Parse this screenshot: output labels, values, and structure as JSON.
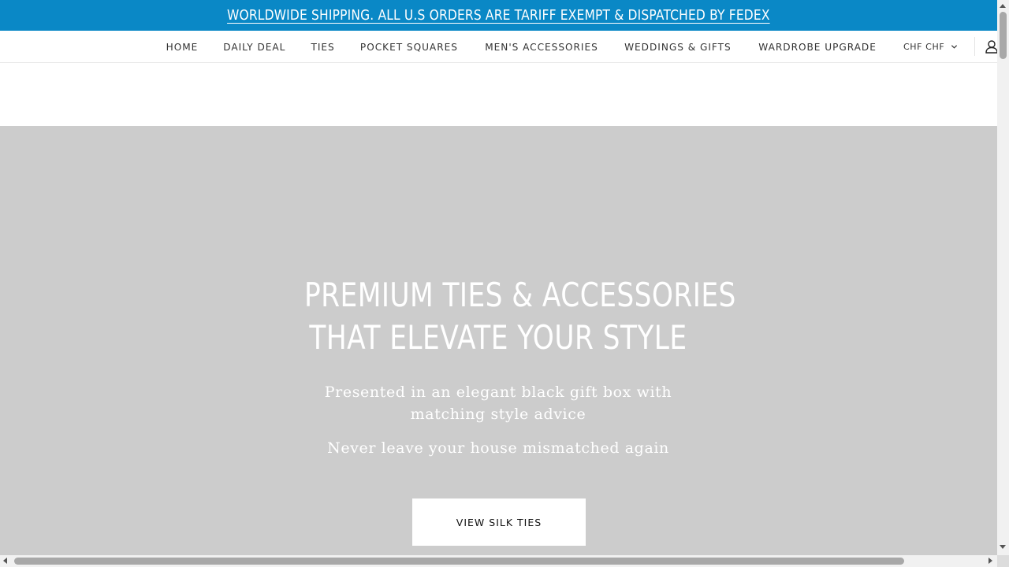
{
  "announcement": {
    "text": "WORLDWIDE SHIPPING. ALL U.S ORDERS ARE TARIFF EXEMPT & DISPATCHED BY FEDEX",
    "background": "#0a88c6"
  },
  "nav": {
    "items": [
      {
        "label": "HOME"
      },
      {
        "label": "DAILY DEAL"
      },
      {
        "label": "TIES"
      },
      {
        "label": "POCKET SQUARES"
      },
      {
        "label": "MEN'S ACCESSORIES"
      },
      {
        "label": "WEDDINGS & GIFTS"
      },
      {
        "label": "WARDROBE UPGRADE"
      }
    ],
    "currency": "CHF CHF",
    "currency_icon": "chevron-down-icon",
    "account_icon": "user-account-icon"
  },
  "hero": {
    "title_line1": "PREMIUM TIES & ACCESSORIES",
    "title_line2": "THAT ELEVATE YOUR STYLE",
    "subtitle": "Presented in an elegant black gift box with matching style advice",
    "tagline": "Never leave your house mismatched again",
    "cta_label": "VIEW SILK TIES",
    "background": "#cccccc"
  }
}
